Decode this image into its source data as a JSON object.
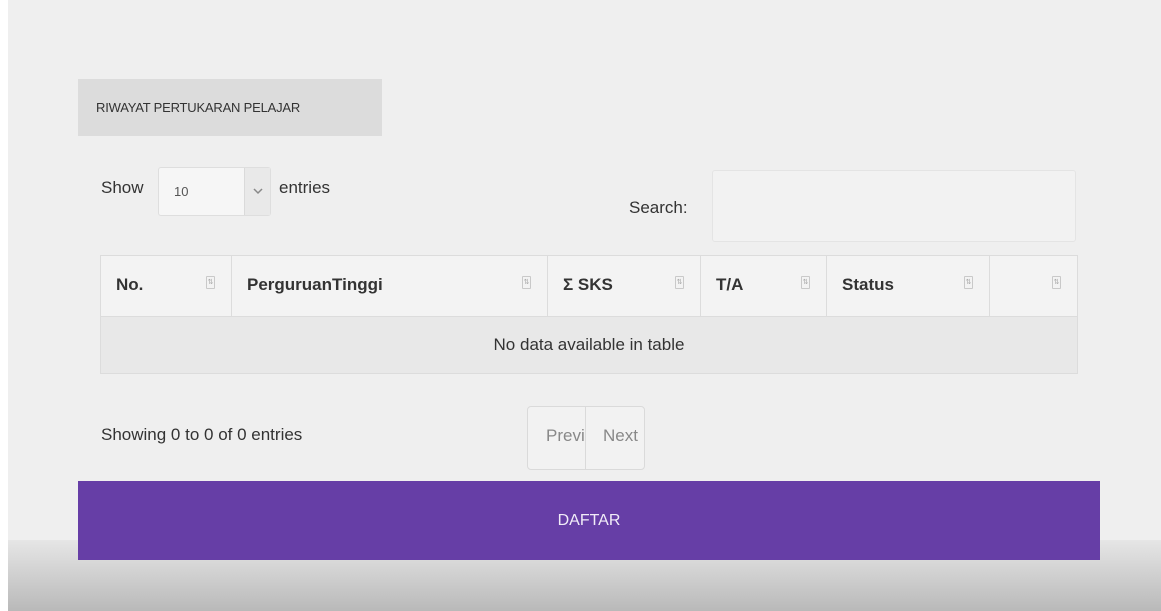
{
  "tab": {
    "label": "RIWAYAT PERTUKARAN PELAJAR"
  },
  "length_control": {
    "show_label": "Show",
    "selected": "10",
    "entries_label": "entries"
  },
  "search": {
    "label": "Search:",
    "value": ""
  },
  "table": {
    "columns": [
      "No.",
      "PerguruanTinggi",
      "Σ SKS",
      "T/A",
      "Status",
      ""
    ],
    "empty_message": "No data available in table"
  },
  "info": "Showing 0 to 0 of 0 entries",
  "pagination": {
    "prev": "Previous",
    "next": "Next"
  },
  "register_button": {
    "label": "DAFTAR"
  },
  "colors": {
    "accent": "#663ea6",
    "background": "#efefef"
  }
}
